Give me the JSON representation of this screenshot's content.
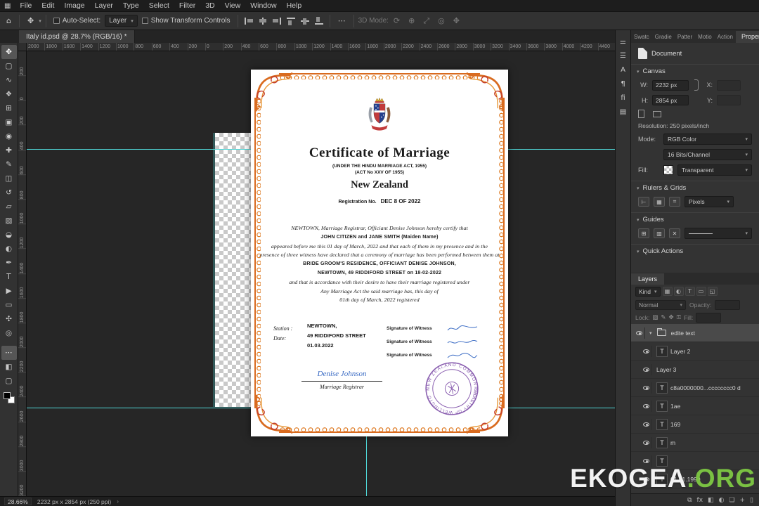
{
  "app": {
    "menu": [
      "File",
      "Edit",
      "Image",
      "Layer",
      "Type",
      "Select",
      "Filter",
      "3D",
      "View",
      "Window",
      "Help"
    ],
    "doc_tab": "Italy id.psd @ 28.7% (RGB/16) *",
    "options": {
      "auto_select_label": "Auto-Select:",
      "auto_select_value": "Layer",
      "show_transform_label": "Show Transform Controls",
      "mode_3d_label": "3D Mode:"
    },
    "status": {
      "zoom": "28.66%",
      "doc_info": "2232 px x 2854 px (250 ppi)"
    }
  },
  "rulers": {
    "h_ticks": [
      "2000",
      "1800",
      "1600",
      "1400",
      "1200",
      "1000",
      "800",
      "600",
      "400",
      "200",
      "0",
      "200",
      "400",
      "600",
      "800",
      "1000",
      "1200",
      "1400",
      "1600",
      "1800",
      "2000",
      "2200",
      "2400",
      "2600",
      "2800",
      "3000",
      "3200",
      "3400",
      "3600",
      "3800",
      "4000",
      "4200",
      "4400"
    ],
    "v_ticks": [
      "200",
      "0",
      "200",
      "400",
      "600",
      "800",
      "1000",
      "1200",
      "1400",
      "1600",
      "1800",
      "2000",
      "2200",
      "2400",
      "2600",
      "2800",
      "3000",
      "3200"
    ]
  },
  "tools": [
    {
      "name": "move-tool",
      "glyph": "✥"
    },
    {
      "name": "marquee-tool",
      "glyph": "▢"
    },
    {
      "name": "lasso-tool",
      "glyph": "∿"
    },
    {
      "name": "object-selection-tool",
      "glyph": "❖"
    },
    {
      "name": "crop-tool",
      "glyph": "⊞"
    },
    {
      "name": "frame-tool",
      "glyph": "▣"
    },
    {
      "name": "eyedropper-tool",
      "glyph": "◉"
    },
    {
      "name": "healing-brush-tool",
      "glyph": "✚"
    },
    {
      "name": "brush-tool",
      "glyph": "✎"
    },
    {
      "name": "clone-stamp-tool",
      "glyph": "◫"
    },
    {
      "name": "history-brush-tool",
      "glyph": "↺"
    },
    {
      "name": "eraser-tool",
      "glyph": "▱"
    },
    {
      "name": "gradient-tool",
      "glyph": "▨"
    },
    {
      "name": "blur-tool",
      "glyph": "◒"
    },
    {
      "name": "dodge-tool",
      "glyph": "◐"
    },
    {
      "name": "pen-tool",
      "glyph": "✒"
    },
    {
      "name": "type-tool",
      "glyph": "T"
    },
    {
      "name": "path-selection-tool",
      "glyph": "▶"
    },
    {
      "name": "shape-tool",
      "glyph": "▭"
    },
    {
      "name": "hand-tool",
      "glyph": "✣"
    },
    {
      "name": "zoom-tool",
      "glyph": "◎"
    }
  ],
  "tools_extra": [
    {
      "name": "edit-toolbar-icon",
      "glyph": "⋯"
    },
    {
      "name": "quick-mask-icon",
      "glyph": "◧"
    },
    {
      "name": "screen-mode-icon",
      "glyph": "▢"
    }
  ],
  "panel_strip": [
    {
      "name": "adjustments-panel-icon",
      "glyph": "⚌"
    },
    {
      "name": "clone-source-panel-icon",
      "glyph": "☰"
    },
    {
      "name": "character-panel-icon",
      "glyph": "A"
    },
    {
      "name": "paragraph-panel-icon",
      "glyph": "¶"
    },
    {
      "name": "glyphs-panel-icon",
      "glyph": "ﬁ"
    },
    {
      "name": "libraries-panel-icon",
      "glyph": "▤"
    }
  ],
  "properties": {
    "tabs": [
      "Swatc",
      "Gradie",
      "Patter",
      "Motio",
      "Action"
    ],
    "active_tab": "Properties",
    "document_label": "Document",
    "canvas_section": "Canvas",
    "w_label": "W:",
    "w_value": "2232 px",
    "h_label": "H:",
    "h_value": "2854 px",
    "x_label": "X:",
    "y_label": "Y:",
    "resolution": "Resolution: 250 pixels/inch",
    "mode_label": "Mode:",
    "mode_value": "RGB Color",
    "depth_value": "16 Bits/Channel",
    "fill_label": "Fill:",
    "fill_value": "Transparent",
    "rulers_section": "Rulers & Grids",
    "units_value": "Pixels",
    "guides_section": "Guides",
    "quick_section": "Quick Actions"
  },
  "layers_panel": {
    "tab": "Layers",
    "kind_label": "Kind",
    "blend_mode": "Normal",
    "opacity_label": "Opacity:",
    "lock_label": "Lock:",
    "fill_label": "Fill:",
    "filter_icons": [
      {
        "name": "filter-pixel-layers-icon",
        "glyph": "▦"
      },
      {
        "name": "filter-adjustment-layers-icon",
        "glyph": "◐"
      },
      {
        "name": "filter-text-layers-icon",
        "glyph": "T"
      },
      {
        "name": "filter-shape-layers-icon",
        "glyph": "▭"
      },
      {
        "name": "filter-smart-object-icon",
        "glyph": "◱"
      }
    ],
    "rows": [
      {
        "kind": "group",
        "label": "edite text"
      },
      {
        "kind": "text",
        "label": "Layer 2"
      },
      {
        "kind": "raster",
        "label": "Layer 3"
      },
      {
        "kind": "text",
        "label": "c8a0000000...cccccccc0 d"
      },
      {
        "kind": "text",
        "label": "1ae"
      },
      {
        "kind": "text",
        "label": "169"
      },
      {
        "kind": "text",
        "label": "m"
      },
      {
        "kind": "text",
        "label": ""
      },
      {
        "kind": "text",
        "label": "01.01.1990"
      }
    ],
    "bottom_icons": [
      {
        "name": "link-layers-icon",
        "glyph": "⧉"
      },
      {
        "name": "layer-effects-icon",
        "glyph": "fx"
      },
      {
        "name": "layer-mask-icon",
        "glyph": "◧"
      },
      {
        "name": "adjustment-layer-icon",
        "glyph": "◐"
      },
      {
        "name": "new-group-icon",
        "glyph": "❏"
      },
      {
        "name": "new-layer-icon",
        "glyph": "+"
      },
      {
        "name": "delete-layer-icon",
        "glyph": "▯"
      }
    ]
  },
  "certificate": {
    "title": "Certificate of Marriage",
    "act_line1": "(UNDER THE HINDU MARRIAGE ACT, 1955)",
    "act_line2": "(ACT No XXV OF 1955)",
    "country": "New Zealand",
    "reg_label": "Registration No.",
    "reg_value": "DEC 8 OF 2022",
    "body": [
      "NEWTOWN,  Marriage Registrar,  Officiant Denise Johnson  hereby certify that",
      "JOHN CITIZEN and JANE SMITH  (Maiden Name)",
      "appeared before me this  01  day of  March, 2022  and that each of them in my presence and in the",
      "presence of three witness have declared that a ceremony of marriage has been performed between them at",
      "BRIDE GROOM'S RESIDENCE, OFFICIANT DENISE JOHNSON,",
      "NEWTOWN, 49 RIDDIFORD STREET on 18-02-2022",
      "and that is accordance with their desire to have their marriage registered under",
      "Any Marriage Act the said marriage has, this day of",
      "01th  day of  March, 2022  registered"
    ],
    "station_label": "Station :",
    "date_label": "Date:",
    "station_value": "NEWTOWN,",
    "address_value": "49 RIDDIFORD STREET",
    "date_value": "01.03.2022",
    "witness_label": "Signature of Witness",
    "registrar_signature": "Denise Johnson",
    "registrar_label": "Marriage Registrar",
    "seal_top": "NEW ZEALAND COMMON SEAL",
    "seal_bottom": "REGISTRY OF WELLINGTON CITY"
  },
  "watermark": {
    "left": "EKOGEA",
    "right": ".ORG"
  },
  "colors": {
    "guide_cyan": "#4fd6d6",
    "cert_border_orange": "#d96b1f",
    "signature_blue": "#3a6bc4",
    "seal_purple": "#8a5fb0",
    "watermark_green": "#7ac142"
  }
}
